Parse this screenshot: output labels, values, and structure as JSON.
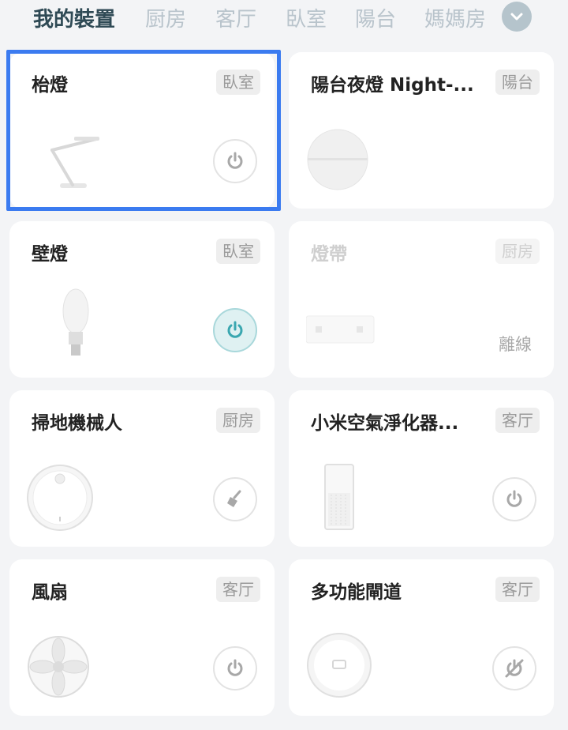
{
  "tabs": [
    "我的裝置",
    "厨房",
    "客厅",
    "臥室",
    "陽台",
    "媽媽房"
  ],
  "devices": [
    {
      "name": "枱燈",
      "room": "臥室",
      "control": "power"
    },
    {
      "name": "陽台夜燈 Night-...",
      "room": "陽台",
      "control": "none"
    },
    {
      "name": "壁燈",
      "room": "臥室",
      "control": "power-on"
    },
    {
      "name": "燈帶",
      "room": "厨房",
      "status": "離線"
    },
    {
      "name": "掃地機械人",
      "room": "厨房",
      "control": "clean"
    },
    {
      "name": "小米空氣淨化器...",
      "room": "客厅",
      "control": "power"
    },
    {
      "name": "風扇",
      "room": "客厅",
      "control": "power"
    },
    {
      "name": "多功能閘道",
      "room": "客厅",
      "control": "disabled"
    }
  ],
  "colors": {
    "accent": "#3b7bf0",
    "active_power": "#3aa7b0"
  }
}
